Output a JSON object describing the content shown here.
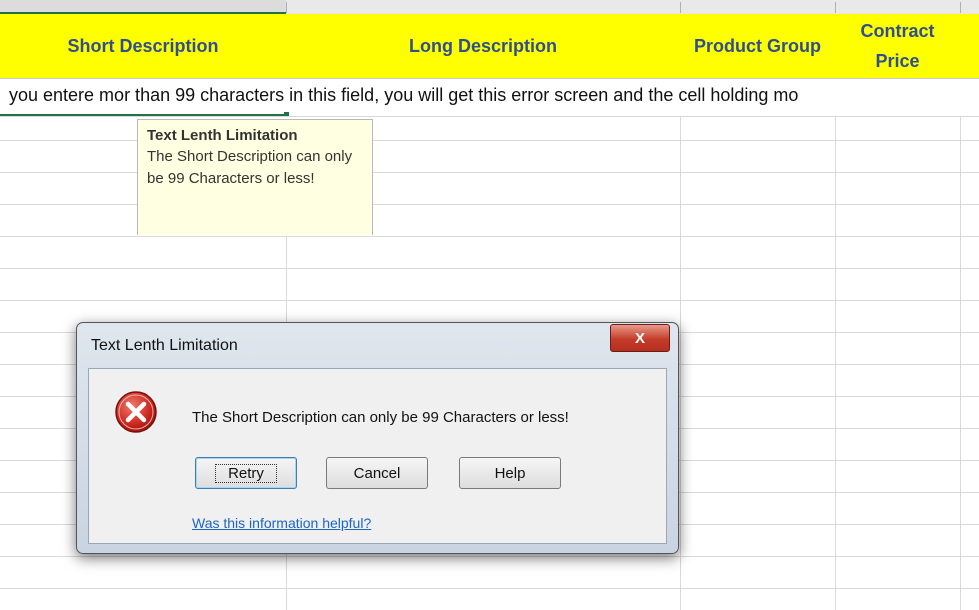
{
  "headers": [
    "Short Description",
    "Long Description",
    "Product Group",
    "Contract Price"
  ],
  "row2_text": "you entere mor than 99 characters in this field, you will get this error screen and the cell holding mo",
  "tooltip": {
    "title": "Text Lenth Limitation",
    "body": "The Short Description can only be 99 Characters or less!"
  },
  "dialog": {
    "title": "Text Lenth Limitation",
    "close_glyph": "X",
    "message": "The Short Description can only be 99 Characters or less!",
    "buttons": [
      "Retry",
      "Cancel",
      "Help"
    ],
    "link": "Was this information helpful?"
  },
  "colors": {
    "header_bg": "#ffff00",
    "header_text": "#2f4f8f",
    "tooltip_bg": "#ffffe1",
    "close_red": "#c43c2a",
    "excel_green": "#217346"
  }
}
